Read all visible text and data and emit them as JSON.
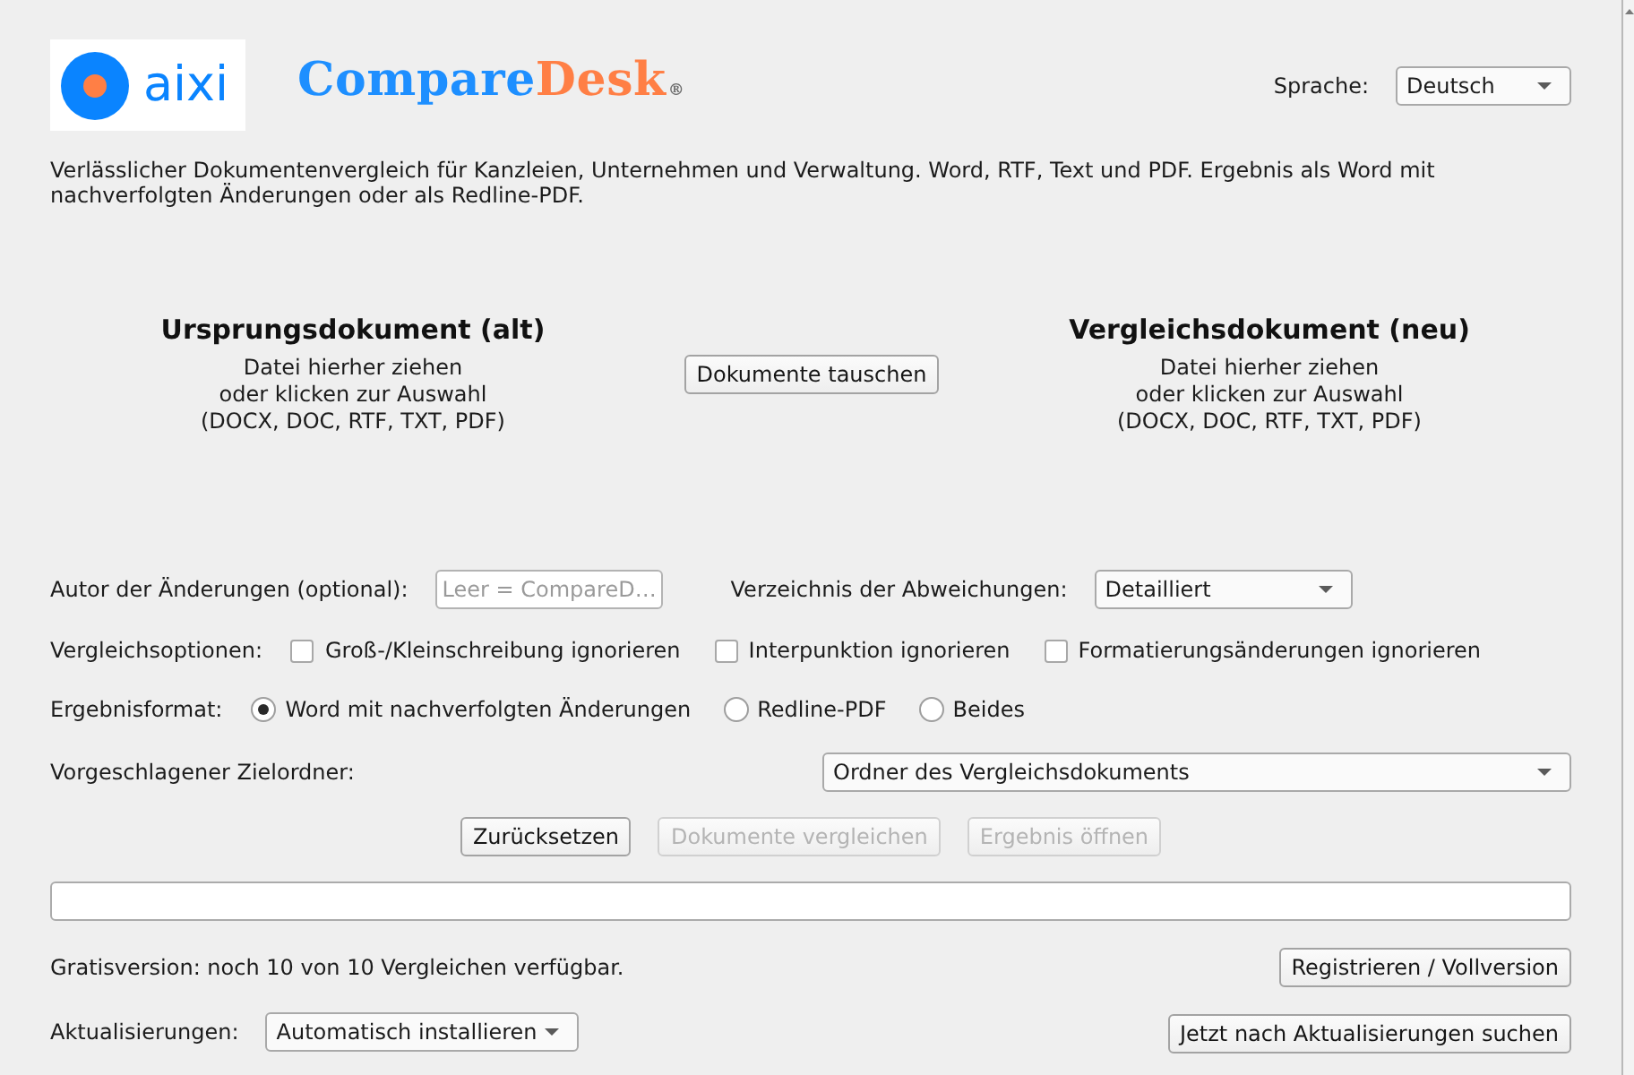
{
  "header": {
    "logo_text": "aixi",
    "title_parts": [
      "Compare",
      "Desk"
    ],
    "trademark": "®",
    "language": {
      "label": "Sprache:",
      "value": "Deutsch"
    }
  },
  "description": "Verlässlicher Dokumentenvergleich für Kanzleien, Unternehmen und Verwaltung. Word, RTF, Text und PDF. Ergebnis als Word mit nachverfolgten Änderungen oder als Redline-PDF.",
  "documents": {
    "original": {
      "title": "Ursprungsdokument (alt)",
      "hint_lines": [
        "Datei hierher ziehen",
        "oder klicken zur Auswahl",
        "(DOCX, DOC, RTF, TXT, PDF)"
      ]
    },
    "swap_button": "Dokumente tauschen",
    "revised": {
      "title": "Vergleichsdokument (neu)",
      "hint_lines": [
        "Datei hierher ziehen",
        "oder klicken zur Auswahl",
        "(DOCX, DOC, RTF, TXT, PDF)"
      ]
    }
  },
  "author": {
    "label": "Autor der Änderungen (optional):",
    "placeholder": "Leer = CompareD…"
  },
  "deviation_list": {
    "label": "Verzeichnis der Abweichungen:",
    "value": "Detailliert"
  },
  "compare_options": {
    "label": "Vergleichsoptionen:",
    "options": [
      {
        "label": "Groß-/Kleinschreibung ignorieren",
        "checked": false
      },
      {
        "label": "Interpunktion ignorieren",
        "checked": false
      },
      {
        "label": "Formatierungsänderungen ignorieren",
        "checked": false
      }
    ]
  },
  "output_format": {
    "label": "Ergebnisformat:",
    "options": [
      {
        "label": "Word mit nachverfolgten Änderungen",
        "selected": true
      },
      {
        "label": "Redline-PDF",
        "selected": false
      },
      {
        "label": "Beides",
        "selected": false
      }
    ]
  },
  "target_folder": {
    "label": "Vorgeschlagener Zielordner:",
    "value": "Ordner des Vergleichsdokuments"
  },
  "actions": [
    {
      "label": "Zurücksetzen",
      "disabled": false
    },
    {
      "label": "Dokumente vergleichen",
      "disabled": true
    },
    {
      "label": "Ergebnis öffnen",
      "disabled": true
    }
  ],
  "progress": {
    "level": 0
  },
  "license": {
    "text": "Gratisversion: noch 10 von 10 Vergleichen verfügbar.",
    "button": "Registrieren / Vollversion"
  },
  "updates": {
    "label": "Aktualisierungen:",
    "value": "Automatisch installieren",
    "button": "Jetzt nach Aktualisierungen suchen"
  }
}
